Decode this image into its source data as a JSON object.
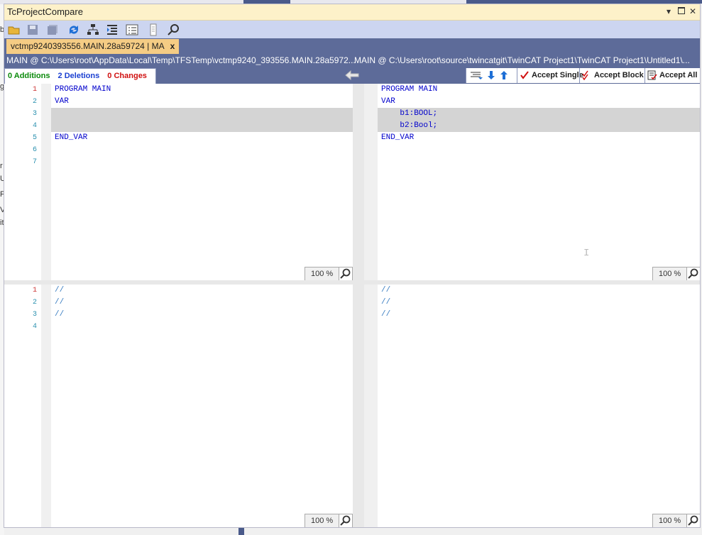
{
  "window": {
    "title": "TcProjectCompare"
  },
  "tab": {
    "label": "vctmp9240393556.MAIN.28a59724 | MA",
    "close": "x"
  },
  "paths": {
    "left": "MAIN   @ C:\\Users\\root\\AppData\\Local\\Temp\\TFSTemp\\vctmp9240_393556.MAIN.28a5972...",
    "right": "MAIN   @ C:\\Users\\root\\source\\twincatgit\\TwinCAT Project1\\TwinCAT Project1\\Untitled1\\..."
  },
  "diff": {
    "additions": "0 Additions",
    "deletions": "2 Deletions",
    "changes": "0 Changes",
    "accept_single": "Accept Single",
    "accept_block": "Accept Block",
    "accept_all": "Accept All",
    "colors": {
      "additions": "#0a8a0a",
      "deletions": "#1a3fd1",
      "changes": "#d01010"
    }
  },
  "top_left": {
    "line_numbers": [
      "1",
      "2",
      "3",
      "4",
      "5",
      "6",
      "7"
    ],
    "lines": [
      "PROGRAM MAIN",
      "VAR",
      "",
      "",
      "END_VAR",
      "",
      ""
    ]
  },
  "top_right": {
    "lines": [
      "PROGRAM MAIN",
      "VAR",
      "    b1:BOOL;",
      "    b2:Bool;",
      "END_VAR"
    ]
  },
  "bottom_left": {
    "line_numbers": [
      "1",
      "2",
      "3",
      "4"
    ],
    "lines": [
      "//",
      "//",
      "//",
      ""
    ]
  },
  "bottom_right": {
    "lines": [
      "//",
      "//",
      "//"
    ]
  },
  "zoom": {
    "label": "100 %"
  },
  "background": {
    "left_fragments": [
      "b",
      "g",
      "r",
      "U",
      "F",
      "V",
      "it"
    ]
  }
}
